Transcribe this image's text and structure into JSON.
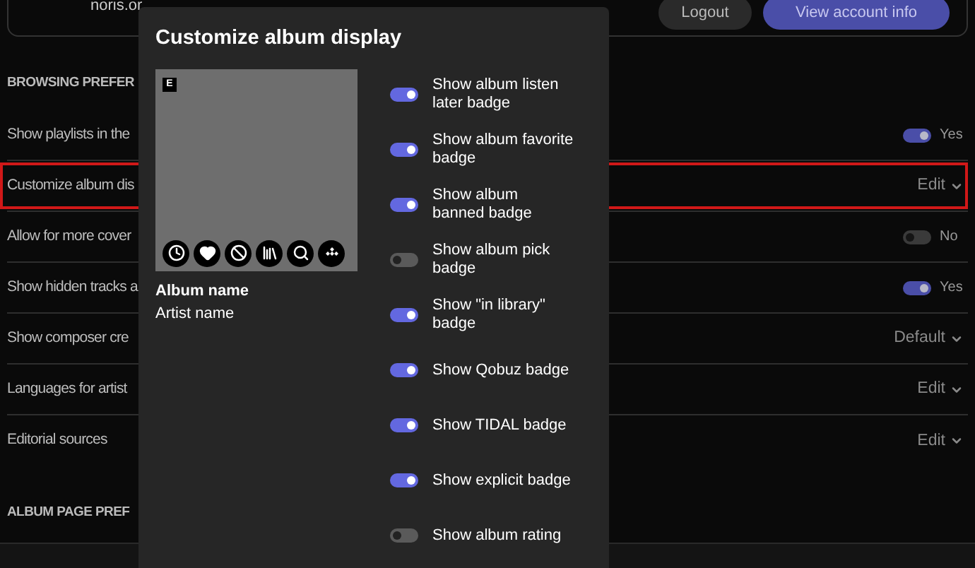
{
  "account": {
    "email": "noris.or",
    "buttons": [
      {
        "label": "Logout",
        "kind": "secondary"
      },
      {
        "label": "View account info",
        "kind": "primary"
      }
    ]
  },
  "sections": [
    {
      "title": "BROWSING PREFER",
      "rows": [
        {
          "label": "Show playlists in the",
          "kind": "toggle",
          "on": true,
          "value": "Yes",
          "highlighted": false
        },
        {
          "label": "Customize album dis",
          "kind": "select",
          "value": "Edit",
          "highlighted": true
        },
        {
          "label": "Allow for more cover",
          "kind": "toggle",
          "on": false,
          "value": "No",
          "highlighted": false
        },
        {
          "label": "Show hidden tracks a",
          "kind": "toggle",
          "on": true,
          "value": "Yes",
          "highlighted": false
        },
        {
          "label": "Show composer cre",
          "kind": "select",
          "value": "Default",
          "highlighted": false
        },
        {
          "label": "Languages for artist",
          "kind": "select",
          "value": "Edit",
          "highlighted": false
        },
        {
          "label": "Editorial sources",
          "kind": "select",
          "value": "Edit",
          "highlighted": false
        }
      ]
    },
    {
      "title": "ALBUM PAGE PREF"
    }
  ],
  "dialog": {
    "title": "Customize album display",
    "cover_badge": "E",
    "album_name": "Album name",
    "artist_name": "Artist name",
    "options": [
      {
        "label": "Show album listen later badge",
        "on": true
      },
      {
        "label": "Show album favorite badge",
        "on": true
      },
      {
        "label": "Show album banned badge",
        "on": true
      },
      {
        "label": "Show album pick badge",
        "on": false
      },
      {
        "label": "Show \"in library\" badge",
        "on": true
      },
      {
        "label": "Show Qobuz badge",
        "on": true
      },
      {
        "label": "Show TIDAL badge",
        "on": true
      },
      {
        "label": "Show explicit badge",
        "on": true
      },
      {
        "label": "Show album rating",
        "on": false
      }
    ]
  }
}
